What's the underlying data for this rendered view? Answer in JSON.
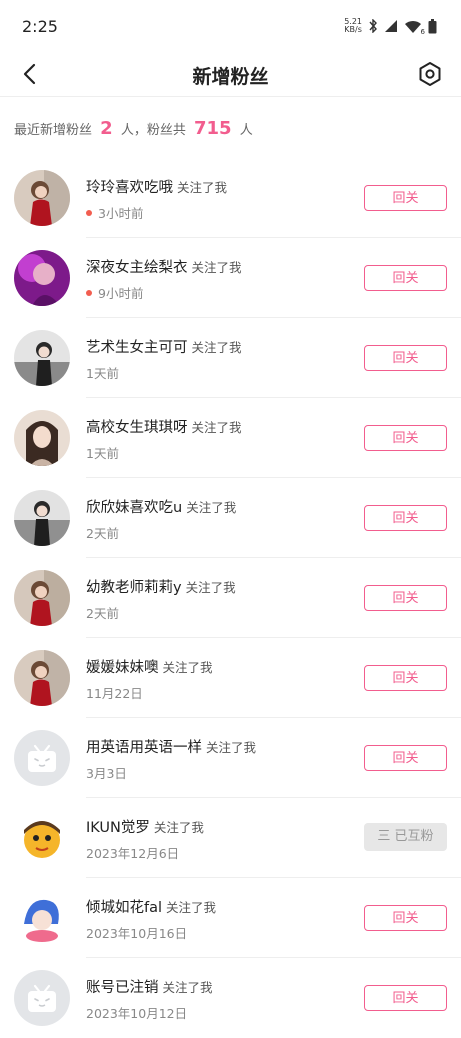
{
  "status": {
    "time": "2:25",
    "net_speed_value": "5.21",
    "net_speed_unit": "KB/s",
    "wifi_badge": "6"
  },
  "header": {
    "title": "新增粉丝"
  },
  "summary": {
    "prefix": "最近新增粉丝",
    "new_count": "2",
    "mid": "人，粉丝共",
    "total": "715",
    "suffix": "人"
  },
  "colors": {
    "accent": "#f25d8e",
    "new_dot": "#f25d4f"
  },
  "fans": [
    {
      "name": "玲玲喜欢吃哦",
      "action": "关注了我",
      "time": "3小时前",
      "is_new": true,
      "button": "回关",
      "mutual": false,
      "avatar": "photo-red-dress"
    },
    {
      "name": "深夜女主绘梨衣",
      "action": "关注了我",
      "time": "9小时前",
      "is_new": true,
      "button": "回关",
      "mutual": false,
      "avatar": "photo-purple"
    },
    {
      "name": "艺术生女主可可",
      "action": "关注了我",
      "time": "1天前",
      "is_new": false,
      "button": "回关",
      "mutual": false,
      "avatar": "photo-sofa"
    },
    {
      "name": "高校女生琪琪呀",
      "action": "关注了我",
      "time": "1天前",
      "is_new": false,
      "button": "回关",
      "mutual": false,
      "avatar": "photo-portrait"
    },
    {
      "name": "欣欣妹喜欢吃u",
      "action": "关注了我",
      "time": "2天前",
      "is_new": false,
      "button": "回关",
      "mutual": false,
      "avatar": "photo-sofa"
    },
    {
      "name": "幼教老师莉莉y",
      "action": "关注了我",
      "time": "2天前",
      "is_new": false,
      "button": "回关",
      "mutual": false,
      "avatar": "photo-red-dress"
    },
    {
      "name": "媛媛妹妹噢",
      "action": "关注了我",
      "time": "11月22日",
      "is_new": false,
      "button": "回关",
      "mutual": false,
      "avatar": "photo-red-dress"
    },
    {
      "name": "用英语用英语一样",
      "action": "关注了我",
      "time": "3月3日",
      "is_new": false,
      "button": "回关",
      "mutual": false,
      "avatar": "default-tv"
    },
    {
      "name": "IKUN觉罗",
      "action": "关注了我",
      "time": "2023年12月6日",
      "is_new": false,
      "button": "三 已互粉",
      "mutual": true,
      "avatar": "cartoon-yellow"
    },
    {
      "name": "倾城如花fal",
      "action": "关注了我",
      "time": "2023年10月16日",
      "is_new": false,
      "button": "回关",
      "mutual": false,
      "avatar": "anime-blue"
    },
    {
      "name": "账号已注销",
      "action": "关注了我",
      "time": "2023年10月12日",
      "is_new": false,
      "button": "回关",
      "mutual": false,
      "avatar": "default-tv"
    }
  ]
}
